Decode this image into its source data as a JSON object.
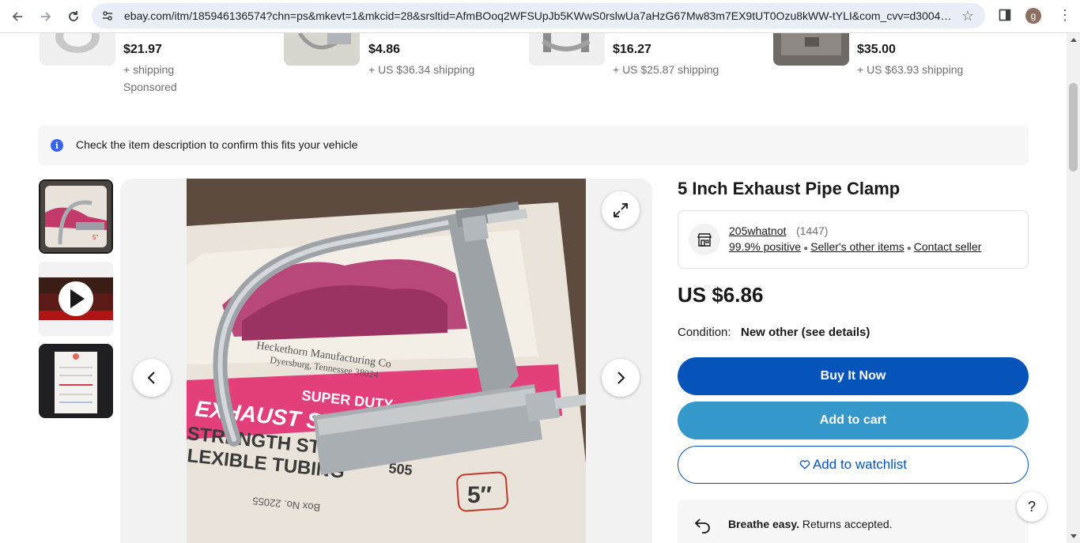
{
  "browser": {
    "url": "ebay.com/itm/185946136574?chn=ps&mkevt=1&mkcid=28&srsltid=AfmBOoq2WFSUpJb5KWwS0rslwUa7aHzG67Mw83m7EX9tUT0Ozu8kWW-tYLI&com_cvv=d300425...",
    "profile_initial": "g"
  },
  "sponsored": [
    {
      "price": "$21.97",
      "shipping": "+ shipping",
      "sponsored_label": "Sponsored"
    },
    {
      "price": "$4.86",
      "shipping": "+ US $36.34 shipping"
    },
    {
      "price": "$16.27",
      "shipping": "+ US $25.87 shipping"
    },
    {
      "price": "$35.00",
      "shipping": "+ US $63.93 shipping"
    }
  ],
  "fitment": {
    "text": "Check the item description to confirm this fits your vehicle",
    "icon": "info-icon"
  },
  "listing": {
    "title": "5 Inch Exhaust Pipe Clamp",
    "seller": {
      "name": "205whatnot",
      "feedback_count": "(1447)",
      "positive": "99.9% positive",
      "other_items": "Seller's other items",
      "contact": "Contact seller"
    },
    "price": "US $6.86",
    "condition_label": "Condition:",
    "condition_value": "New other (see details)",
    "buy_now": "Buy It Now",
    "add_to_cart": "Add to cart",
    "add_to_watchlist": "Add to watchlist",
    "returns_bold": "Breathe easy.",
    "returns_text": " Returns accepted."
  },
  "photo_text": {
    "maker_line1": "Heckethorn Manufacturing Co",
    "maker_line2": "Dyersburg, Tennessee 38024",
    "super_duty": "SUPER DUTY",
    "exhaust": "EXHAUST SYS",
    "strength": "STRENGTH STE",
    "flexible": "LEXIBLE TUBING",
    "size": "5″",
    "box_no": "Box No. 22055",
    "partial_code": "505"
  },
  "help": "?"
}
